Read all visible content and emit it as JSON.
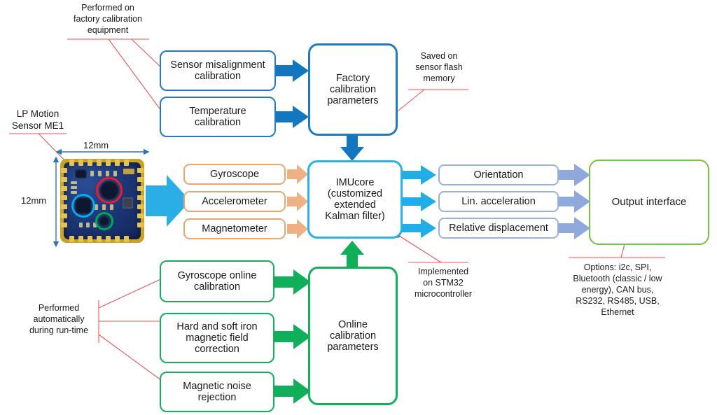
{
  "diagram": {
    "title": "LP Motion Sensor ME1 processing pipeline",
    "colors": {
      "blue": "#1F7AC0",
      "cyan": "#27B3E8",
      "orange": "#E8A671",
      "green": "#10B05A",
      "light_green": "#76C043",
      "slate_blue": "#9BB0DC",
      "annotation_red": "#E8555A"
    }
  },
  "annotations": {
    "factory_note": "Performed on\nfactory calibration\nequipment",
    "factory_note_lines": [
      "Performed  on",
      "factory calibration",
      "equipment"
    ],
    "sensor_label_lines": [
      "LP Motion",
      "Sensor ME1"
    ],
    "saved_note_lines": [
      "Saved on",
      "sensor flash",
      "memory"
    ],
    "implemented_note_lines": [
      "Implemented",
      "on STM32",
      "microcontroller"
    ],
    "runtime_note_lines": [
      "Performed",
      "automatically",
      "during run-time"
    ],
    "options_note_lines": [
      "Options: i2c, SPI,",
      "Bluetooth (classic / low",
      "energy), CAN bus,",
      "RS232, RS485, USB,",
      "Ethernet"
    ]
  },
  "board": {
    "width_label": "12mm",
    "height_label": "12mm",
    "markers": [
      {
        "name": "gyroscope-marker",
        "color": "#00AEEF"
      },
      {
        "name": "accelerometer-marker",
        "color": "#ED1C24"
      },
      {
        "name": "magnetometer-marker",
        "color": "#00A651"
      }
    ]
  },
  "factory_calibration": {
    "inputs": [
      {
        "lines": [
          "Sensor misalignment",
          "calibration"
        ]
      },
      {
        "lines": [
          "Temperature",
          "calibration"
        ]
      }
    ],
    "store": {
      "lines": [
        "Factory",
        "calibration",
        "parameters"
      ]
    }
  },
  "sensors": [
    {
      "label": "Gyroscope"
    },
    {
      "label": "Accelerometer"
    },
    {
      "label": "Magnetometer"
    }
  ],
  "core": {
    "lines": [
      "IMUcore",
      "(customized",
      "extended",
      "Kalman filter)"
    ]
  },
  "outputs": [
    {
      "label": "Orientation"
    },
    {
      "label": "Lin. acceleration"
    },
    {
      "label": "Relative displacement"
    }
  ],
  "output_interface": {
    "label": "Output interface"
  },
  "online_calibration": {
    "inputs": [
      {
        "lines": [
          "Gyroscope online",
          "calibration"
        ]
      },
      {
        "lines": [
          "Hard and soft iron",
          "magnetic field",
          "correction"
        ]
      },
      {
        "lines": [
          "Magnetic noise",
          "rejection"
        ]
      }
    ],
    "store": {
      "lines": [
        "Online",
        "calibration",
        "parameters"
      ]
    }
  }
}
